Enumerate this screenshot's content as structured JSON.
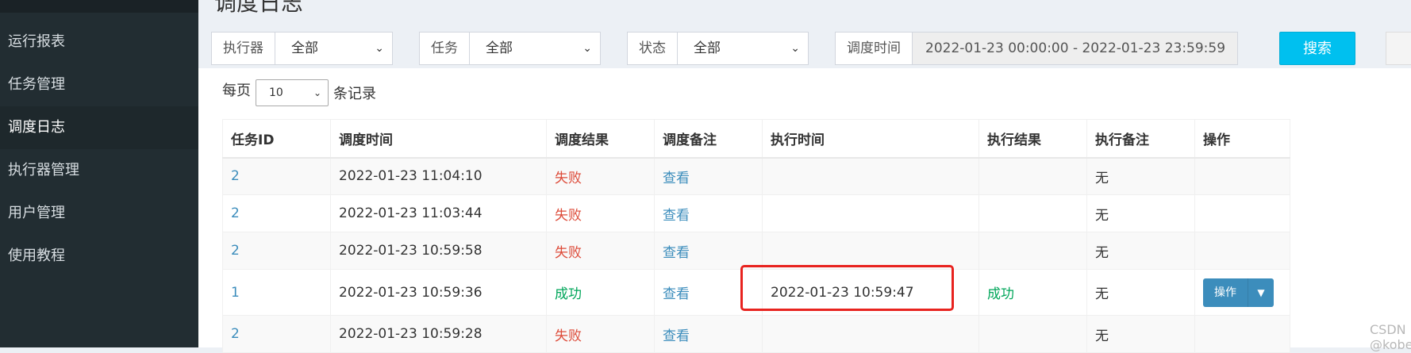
{
  "sidebar": {
    "items": [
      {
        "label": "运行报表"
      },
      {
        "label": "任务管理"
      },
      {
        "label": "调度日志",
        "active": true
      },
      {
        "label": "执行器管理"
      },
      {
        "label": "用户管理"
      },
      {
        "label": "使用教程"
      }
    ]
  },
  "page": {
    "title": "调度日志"
  },
  "filters": {
    "executor": {
      "label": "执行器",
      "value": "全部"
    },
    "task": {
      "label": "任务",
      "value": "全部"
    },
    "status": {
      "label": "状态",
      "value": "全部"
    },
    "time": {
      "label": "调度时间",
      "value": "2022-01-23 00:00:00 - 2022-01-23 23:59:59"
    },
    "search_label": "搜索"
  },
  "paging": {
    "prefix": "每页",
    "value": "10",
    "suffix": "条记录"
  },
  "table": {
    "headers": [
      "任务ID",
      "调度时间",
      "调度结果",
      "调度备注",
      "执行时间",
      "执行结果",
      "执行备注",
      "操作"
    ],
    "rows": [
      {
        "id": "2",
        "trigger_time": "2022-01-23 11:04:10",
        "trigger_result": "失败",
        "trigger_note": "查看",
        "exec_time": "",
        "exec_result": "",
        "exec_note": "无"
      },
      {
        "id": "2",
        "trigger_time": "2022-01-23 11:03:44",
        "trigger_result": "失败",
        "trigger_note": "查看",
        "exec_time": "",
        "exec_result": "",
        "exec_note": "无"
      },
      {
        "id": "2",
        "trigger_time": "2022-01-23 10:59:58",
        "trigger_result": "失败",
        "trigger_note": "查看",
        "exec_time": "",
        "exec_result": "",
        "exec_note": "无"
      },
      {
        "id": "1",
        "trigger_time": "2022-01-23 10:59:36",
        "trigger_result": "成功",
        "trigger_note": "查看",
        "exec_time": "2022-01-23 10:59:47",
        "exec_result": "成功",
        "exec_note": "无",
        "action": "操作"
      },
      {
        "id": "2",
        "trigger_time": "2022-01-23 10:59:28",
        "trigger_result": "失败",
        "trigger_note": "查看",
        "exec_time": "",
        "exec_result": "",
        "exec_note": "无"
      }
    ]
  },
  "watermark": "CSDN @kobe_t",
  "colors": {
    "sidebar_bg": "#222d32",
    "link": "#3c8dbc",
    "fail": "#dd4b39",
    "success": "#00a65a",
    "search_btn": "#00c0ef",
    "highlight_box": "#e8231f"
  }
}
